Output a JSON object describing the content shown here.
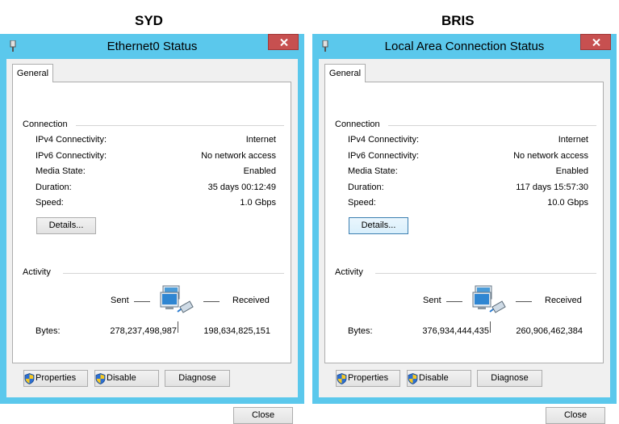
{
  "windows": [
    {
      "heading": "SYD",
      "title": "Ethernet0 Status",
      "tab": "General",
      "connection_group": "Connection",
      "rows": [
        {
          "label": "IPv4 Connectivity:",
          "value": "Internet"
        },
        {
          "label": "IPv6 Connectivity:",
          "value": "No network access"
        },
        {
          "label": "Media State:",
          "value": "Enabled"
        },
        {
          "label": "Duration:",
          "value": "35 days 00:12:49"
        },
        {
          "label": "Speed:",
          "value": "1.0 Gbps"
        }
      ],
      "details_label": "Details...",
      "activity_group": "Activity",
      "sent_label": "Sent",
      "received_label": "Received",
      "bytes_label": "Bytes:",
      "bytes_sent": "278,237,498,987",
      "bytes_received": "198,634,825,151",
      "properties_label": "Properties",
      "disable_label": "Disable",
      "diagnose_label": "Diagnose",
      "close_label": "Close"
    },
    {
      "heading": "BRIS",
      "title": "Local Area Connection Status",
      "tab": "General",
      "connection_group": "Connection",
      "rows": [
        {
          "label": "IPv4 Connectivity:",
          "value": "Internet"
        },
        {
          "label": "IPv6 Connectivity:",
          "value": "No network access"
        },
        {
          "label": "Media State:",
          "value": "Enabled"
        },
        {
          "label": "Duration:",
          "value": "117 days 15:57:30"
        },
        {
          "label": "Speed:",
          "value": "10.0 Gbps"
        }
      ],
      "details_label": "Details...",
      "activity_group": "Activity",
      "sent_label": "Sent",
      "received_label": "Received",
      "bytes_label": "Bytes:",
      "bytes_sent": "376,934,444,435",
      "bytes_received": "260,906,462,384",
      "properties_label": "Properties",
      "disable_label": "Disable",
      "diagnose_label": "Diagnose",
      "close_label": "Close"
    }
  ],
  "colors": {
    "window_frame": "#5bc8ec",
    "close_button": "#c75050",
    "dialog_background": "#f0f0f0",
    "panel_background": "#ffffff"
  },
  "icons": [
    "network-adapter-icon",
    "close-icon",
    "uac-shield-icon",
    "computers-network-icon"
  ]
}
